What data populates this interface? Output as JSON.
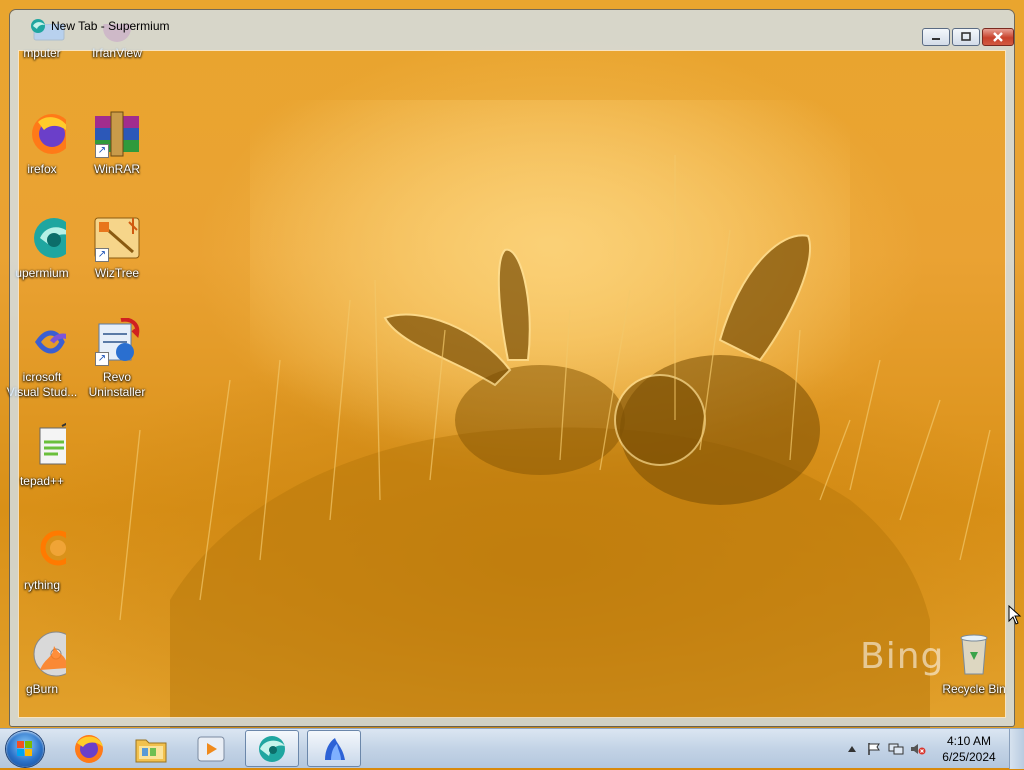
{
  "window": {
    "title": "New Tab - Supermium"
  },
  "desktop_icons": [
    {
      "label": "mputer",
      "icon": "computer-icon"
    },
    {
      "label": "IrfanView",
      "icon": "irfanview-icon"
    },
    {
      "label": "irefox",
      "icon": "firefox-icon"
    },
    {
      "label": "WinRAR",
      "icon": "winrar-icon"
    },
    {
      "label": "upermium",
      "icon": "supermium-icon"
    },
    {
      "label": "WizTree",
      "icon": "wiztree-icon"
    },
    {
      "label": "icrosoft",
      "label2": "Visual Stud...",
      "icon": "visual-studio-icon"
    },
    {
      "label": "Revo",
      "label2": "Uninstaller",
      "icon": "revo-uninstaller-icon"
    },
    {
      "label": "tepad++",
      "icon": "notepad-plus-plus-icon"
    },
    {
      "label": "rything",
      "icon": "everything-icon"
    },
    {
      "label": "gBurn",
      "icon": "imgburn-icon"
    },
    {
      "label": "Recycle Bin",
      "icon": "recycle-bin-icon"
    }
  ],
  "wallpaper": {
    "watermark": "Bing"
  },
  "taskbar": {
    "buttons": [
      {
        "name": "firefox",
        "icon": "firefox-icon"
      },
      {
        "name": "file-explorer",
        "icon": "folder-icon"
      },
      {
        "name": "media-player",
        "icon": "media-player-icon"
      },
      {
        "name": "supermium",
        "icon": "supermium-icon",
        "active": true
      },
      {
        "name": "app",
        "icon": "blue-app-icon",
        "active": true
      }
    ],
    "clock": {
      "time": "4:10 AM",
      "date": "6/25/2024"
    }
  },
  "colors": {
    "wallpaper": "#e9a52e",
    "taskbar": "#c3d3e6",
    "close_button": "#c8422c"
  }
}
